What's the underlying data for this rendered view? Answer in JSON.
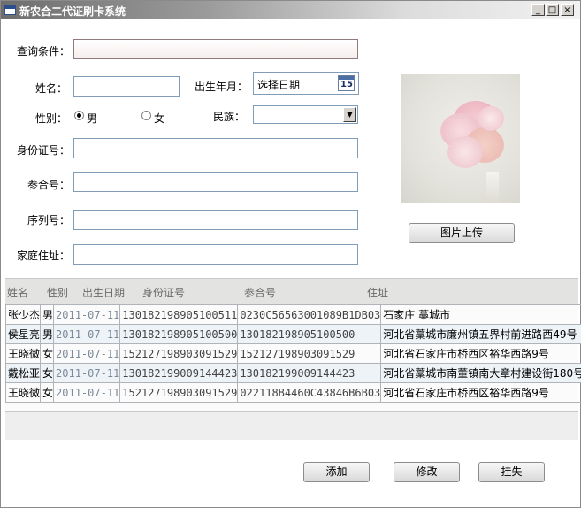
{
  "window": {
    "title": "新农合二代证刷卡系统",
    "controls": {
      "minimize": "_",
      "maximize": "□",
      "close": "×"
    }
  },
  "form": {
    "query_label": "查询条件：",
    "name_label": "姓名：",
    "birth_label": "出生年月：",
    "birth_value": "选择日期",
    "calendar_day": "15",
    "gender_label": "性别：",
    "male_label": "男",
    "female_label": "女",
    "gender_selected": "男",
    "ethnicity_label": "民族：",
    "id_label": "身份证号：",
    "insurance_label": "参合号：",
    "serial_label": "序列号：",
    "address_label": "家庭住址："
  },
  "photo": {
    "upload_button": "图片上传"
  },
  "table": {
    "columns": [
      "姓名",
      "性别",
      "出生日期",
      "身份证号",
      "参合号",
      "住址"
    ],
    "rows": [
      [
        "张少杰",
        "男",
        "2011-07-11",
        "130182198905100511",
        "0230C56563001089B1DB03",
        "石家庄 藁城市"
      ],
      [
        "侯星亮",
        "男",
        "2011-07-11",
        "130182198905100500",
        "130182198905100500",
        "河北省藁城市廉州镇五界村前进路西49号"
      ],
      [
        "王晓微",
        "女",
        "2011-07-11",
        "152127198903091529",
        "152127198903091529",
        "河北省石家庄市桥西区裕华西路9号"
      ],
      [
        "戴松亚",
        "女",
        "2011-07-11",
        "130182199009144423",
        "130182199009144423",
        "河北省藁城市南董镇南大章村建设街180号"
      ],
      [
        "王晓微",
        "女",
        "2011-07-11",
        "152127198903091529",
        "022118B4460C43846B6B03",
        "河北省石家庄市桥西区裕华西路9号"
      ]
    ]
  },
  "actions": {
    "add": "添加",
    "edit": "修改",
    "report_loss": "挂失"
  }
}
